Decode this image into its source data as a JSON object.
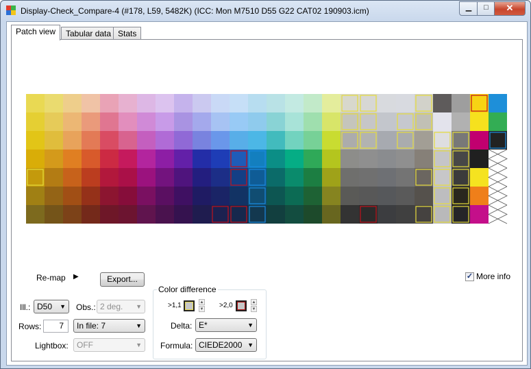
{
  "window": {
    "title": "Display-Check_Compare-4 (#178, L59, 5482K) (ICC: Mon M7510 D55 G22 CAT02 190903.icm)",
    "minimize_glyph": "▁",
    "maximize_glyph": "□",
    "close_glyph": "✕"
  },
  "tabs": [
    {
      "label": "Patch view",
      "active": true
    },
    {
      "label": "Tabular data",
      "active": false
    },
    {
      "label": "Stats",
      "active": false
    }
  ],
  "patches": {
    "columns": 26,
    "rows": 7,
    "colors": [
      [
        "#e9d953",
        "#eadb6f",
        "#eece8b",
        "#f0c3a6",
        "#e9a3b6",
        "#e7b1d0",
        "#ddb7e5",
        "#dcc3ef",
        "#c5b3ec",
        "#cbc9f0",
        "#c9d9f6",
        "#c6dff7",
        "#b7ddf0",
        "#b9e2e6",
        "#c3eae2",
        "#c2eac9",
        "#e4ed9c",
        "#d8d8cc",
        "#d7d7d4",
        "#d8dade",
        "#d8dae0",
        "#d2d2ca",
        "#5e5b5b",
        "#9e9e9e",
        "#f7d314",
        "#1e8fd9"
      ],
      [
        "#e5cf33",
        "#e6cb59",
        "#ecb774",
        "#ea9a7b",
        "#e07691",
        "#e28ebd",
        "#d08ad7",
        "#c89be8",
        "#a993e2",
        "#a4a9ec",
        "#a7c3f3",
        "#98caf5",
        "#8fcbed",
        "#89d3d5",
        "#a8e3d8",
        "#9fdfae",
        "#d8e569",
        "#c5c5bc",
        "#c6c6c7",
        "#c3c6cc",
        "#c6c8ce",
        "#c1c0b5",
        "#e3e3ec",
        "#b1b1b1",
        "#f6e11e",
        "#33ad54"
      ],
      [
        "#e2c517",
        "#e0bd3c",
        "#e8a35b",
        "#e37a56",
        "#d94c63",
        "#d8638f",
        "#c45fbf",
        "#b06bd6",
        "#9069d6",
        "#7983df",
        "#6a97ea",
        "#58aee8",
        "#4cb7e6",
        "#42bbbd",
        "#72d3bf",
        "#77d197",
        "#c9dc31",
        "#acacac",
        "#b2b3b1",
        "#a7aab0",
        "#aaacae",
        "#a29e95",
        "#dedee0",
        "#787878",
        "#c1006f",
        "#222222"
      ],
      [
        "#d9ad08",
        "#d49a1b",
        "#e07f22",
        "#d85a2b",
        "#cc2a43",
        "#c51a5d",
        "#b3259e",
        "#8d1ea5",
        "#6320a8",
        "#232da7",
        "#1e3db6",
        "#1f5cb8",
        "#137fbf",
        "#0b8e86",
        "#05ad85",
        "#2fa958",
        "#b4c51e",
        "#8d8d8a",
        "#8f8f8f",
        "#8a8c8f",
        "#8f8f8f",
        "#868078",
        "#c5c5c8",
        "#474747",
        "#202020",
        "#ffffff"
      ],
      [
        "#c49a0c",
        "#b37c14",
        "#c7621b",
        "#bb3d1f",
        "#b2183c",
        "#aa1048",
        "#9b127e",
        "#73137e",
        "#4f147d",
        "#231e7f",
        "#1c2e87",
        "#143f85",
        "#0f5c96",
        "#0b6b69",
        "#0a8b6c",
        "#1c7e42",
        "#9fa219",
        "#6f6f6d",
        "#707070",
        "#6e7074",
        "#747474",
        "#6b6660",
        "#c7c7c9",
        "#3b3b3b",
        "#f5e320",
        "#ffffff"
      ],
      [
        "#a08014",
        "#946416",
        "#a14f15",
        "#953119",
        "#8c1530",
        "#860d3a",
        "#7a1061",
        "#5a0f61",
        "#3f1062",
        "#1f1b63",
        "#1a2466",
        "#123364",
        "#104d72",
        "#0d5652",
        "#0c6b54",
        "#1e6234",
        "#868420",
        "#5a5a57",
        "#585858",
        "#56585b",
        "#5a5a5a",
        "#55514c",
        "#bdbdbf",
        "#2a271e",
        "#ef7f1a",
        "#ffffff"
      ],
      [
        "#7d6a1e",
        "#745419",
        "#7c4218",
        "#74291a",
        "#6e1728",
        "#6c1430",
        "#60144e",
        "#4a124e",
        "#35124f",
        "#1f1c4f",
        "#1c2150",
        "#16284d",
        "#13384f",
        "#123f3f",
        "#134d40",
        "#1d4a2b",
        "#68661f",
        "#333333",
        "#2b2b2b",
        "#3c3d40",
        "#404040",
        "#454240",
        "#b9b9ba",
        "#252528",
        "#c40f8a",
        "#ffffff"
      ]
    ],
    "diff1": [
      [
        0,
        17
      ],
      [
        0,
        18
      ],
      [
        0,
        21
      ],
      [
        1,
        17
      ],
      [
        1,
        18
      ],
      [
        1,
        20
      ],
      [
        1,
        21
      ],
      [
        2,
        17
      ],
      [
        2,
        18
      ],
      [
        2,
        20
      ],
      [
        2,
        22
      ],
      [
        2,
        23
      ],
      [
        3,
        22
      ],
      [
        3,
        23
      ],
      [
        4,
        0
      ],
      [
        4,
        21
      ],
      [
        4,
        23
      ],
      [
        4,
        22
      ],
      [
        5,
        22
      ],
      [
        5,
        23
      ],
      [
        6,
        22
      ],
      [
        6,
        23
      ],
      [
        6,
        21
      ]
    ],
    "diff2": [
      [
        0,
        24
      ],
      [
        3,
        11
      ],
      [
        4,
        11
      ],
      [
        6,
        10
      ],
      [
        6,
        11
      ],
      [
        6,
        18
      ]
    ],
    "diffblue": [
      [
        3,
        12
      ],
      [
        4,
        12
      ],
      [
        5,
        12
      ],
      [
        6,
        12
      ],
      [
        2,
        25
      ],
      [
        3,
        11
      ]
    ],
    "cross": [
      [
        3,
        25
      ],
      [
        4,
        25
      ],
      [
        5,
        25
      ],
      [
        6,
        25
      ]
    ]
  },
  "controls": {
    "remap_label": "Re-map",
    "export_label": "Export...",
    "more_info_label": "More info",
    "more_info_checked": "✓",
    "ill_label": "Ill.:",
    "ill_value": "D50",
    "obs_label": "Obs.:",
    "obs_value": "2 deg.",
    "rows_label": "Rows:",
    "rows_value": "7",
    "infile_value": "In file: 7",
    "lightbox_label": "Lightbox:",
    "lightbox_value": "OFF",
    "color_diff_title": "Color difference",
    "thresh1_label": ">1,1",
    "thresh2_label": ">2,0",
    "delta_label": "Delta:",
    "delta_value": "E*",
    "formula_label": "Formula:",
    "formula_value": "CIEDE2000",
    "thresh1_color": "#e8dc50",
    "thresh2_color": "#b01010"
  }
}
